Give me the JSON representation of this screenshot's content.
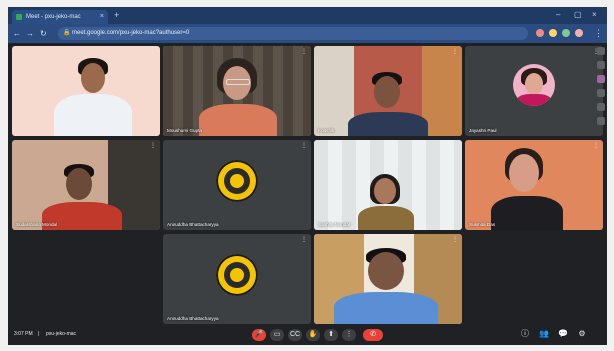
{
  "browser": {
    "tab_title": "Meet - pxu-jeko-mac",
    "tab_close": "×",
    "new_tab": "+",
    "url": "meet.google.com/pxu-jeko-mac?authuser=0",
    "lock": "🔒",
    "menu": "⋮",
    "controls": {
      "minimize": "–",
      "maximize": "▢",
      "close": "×"
    },
    "nav": {
      "back": "←",
      "forward": "→",
      "reload": "↻"
    }
  },
  "participants": [
    {
      "name": "",
      "more": "⋮"
    },
    {
      "name": "Moushumi Gupta",
      "more": "⋮"
    },
    {
      "name": "Koushik",
      "more": "⋮"
    },
    {
      "name": "Jayashri Paul",
      "more": "⋮"
    },
    {
      "name": "Sudarshana Mondal",
      "more": "⋮"
    },
    {
      "name": "Aniruddha Bhattacharyya",
      "more": "⋮"
    },
    {
      "name": "Sanhita Mondal",
      "more": "⋮"
    },
    {
      "name": "Susmita Das",
      "more": "⋮"
    },
    {
      "name": "Aniruddha Bhattacharyya",
      "more": "⋮"
    },
    {
      "name": "",
      "more": "⋮"
    }
  ],
  "bottom_bar": {
    "time": "3:07 PM",
    "separator": "|",
    "meeting_code": "pxu-jeko-mac"
  },
  "controls": {
    "mic": "🎤",
    "camera": "▭",
    "captions": "CC",
    "raise_hand": "✋",
    "present": "⬆",
    "more": "⋮",
    "end_call": "✆"
  },
  "right_controls": {
    "info": "ⓘ",
    "people": "👥",
    "chat": "💬",
    "activities": "⚙"
  },
  "colors": {
    "meet_bg": "#202124",
    "tile_bg": "#3c4043",
    "active_speaker": "#8ab4f8",
    "end_call": "#ea4335",
    "logo_yellow": "#f4c400"
  }
}
